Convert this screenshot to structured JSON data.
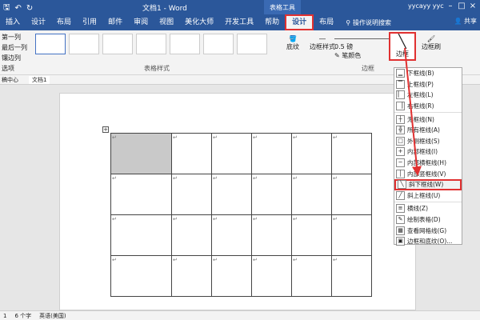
{
  "titlebar": {
    "title": "文档1 - Word",
    "context_group": "表格工具",
    "user": "yycayy yyc",
    "qat": [
      "save",
      "undo",
      "redo"
    ]
  },
  "tabs": [
    "插入",
    "设计",
    "布局",
    "引用",
    "邮件",
    "审阅",
    "视图",
    "美化大师",
    "开发工具",
    "帮助",
    "设计",
    "布局"
  ],
  "active_tab_index": 10,
  "search_text": "操作说明搜索",
  "share_label": "共享",
  "ribbon": {
    "options": [
      "第一列",
      "最后一列",
      "镶边列",
      "选项"
    ],
    "styles_label": "表格样式",
    "shading_label": "底纹",
    "border_styles_label": "边框样式",
    "line_weight": "0.5 磅",
    "pen_color_label": "笔颜色",
    "borders_btn_label": "边框",
    "border_painter_label": "边框刷",
    "borders_group_label": "边框"
  },
  "doctabs": {
    "left": "稿中心",
    "doc": "文档1"
  },
  "table_cell_mark": "↵",
  "statusbar": {
    "page": "1",
    "words": "6 个字",
    "lang": "英语(美国)"
  },
  "menu": [
    {
      "label": "下框线(B)",
      "icon": "▁"
    },
    {
      "label": "上框线(P)",
      "icon": "▔"
    },
    {
      "label": "左框线(L)",
      "icon": "▏"
    },
    {
      "label": "右框线(R)",
      "icon": "▕"
    },
    {
      "label": "无框线(N)",
      "icon": "┼"
    },
    {
      "label": "所有框线(A)",
      "icon": "╬"
    },
    {
      "label": "外侧框线(S)",
      "icon": "□"
    },
    {
      "label": "内部框线(I)",
      "icon": "+"
    },
    {
      "label": "内部横框线(H)",
      "icon": "─"
    },
    {
      "label": "内部竖框线(V)",
      "icon": "│"
    },
    {
      "label": "斜下框线(W)",
      "icon": "╲"
    },
    {
      "label": "斜上框线(U)",
      "icon": "╱"
    },
    {
      "label": "横线(Z)",
      "icon": "≡"
    },
    {
      "label": "绘制表格(D)",
      "icon": "✎"
    },
    {
      "label": "查看网格线(G)",
      "icon": "▦"
    },
    {
      "label": "边框和底纹(O)...",
      "icon": "▣"
    }
  ],
  "highlighted_menu_index": 10,
  "colors": {
    "brand": "#2b579a",
    "highlight": "#e03131"
  }
}
